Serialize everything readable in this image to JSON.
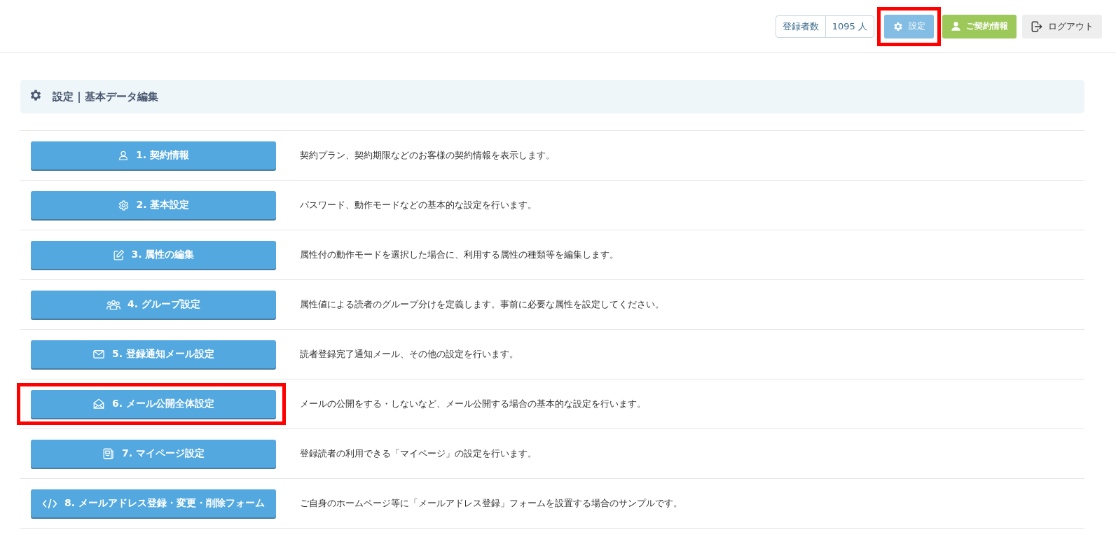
{
  "header": {
    "subscriber_count": {
      "label": "登録者数",
      "value": "1095 人"
    },
    "buttons": [
      {
        "kind": "settings",
        "label": "設定",
        "highlighted": true
      },
      {
        "kind": "contract",
        "label": "ご契約情報",
        "highlighted": false
      },
      {
        "kind": "logout",
        "label": "ログアウト",
        "highlighted": false
      }
    ]
  },
  "page_title": "設定 | 基本データ編集",
  "menu": [
    {
      "kind": "user",
      "label": "1. 契約情報",
      "description": "契約プラン、契約期限などのお客様の契約情報を表示します。",
      "highlighted": false
    },
    {
      "kind": "gear",
      "label": "2. 基本設定",
      "description": "パスワード、動作モードなどの基本的な設定を行います。",
      "highlighted": false
    },
    {
      "kind": "edit",
      "label": "3. 属性の編集",
      "description": "属性付の動作モードを選択した場合に、利用する属性の種類等を編集します。",
      "highlighted": false
    },
    {
      "kind": "group",
      "label": "4. グループ設定",
      "description": "属性値による読者のグループ分けを定義します。事前に必要な属性を設定してください。",
      "highlighted": false
    },
    {
      "kind": "mail",
      "label": "5. 登録通知メール設定",
      "description": "読者登録完了通知メール、その他の設定を行います。",
      "highlighted": false
    },
    {
      "kind": "mail-open",
      "label": "6. メール公開全体設定",
      "description": "メールの公開をする・しないなど、メール公開する場合の基本的な設定を行います。",
      "highlighted": true
    },
    {
      "kind": "page",
      "label": "7. マイページ設定",
      "description": "登録読者の利用できる「マイページ」の設定を行います。",
      "highlighted": false
    },
    {
      "kind": "code",
      "label": "8. メールアドレス登録・変更・削除フォーム",
      "description": "ご自身のホームページ等に「メールアドレス登録」フォームを設置する場合のサンプルです。",
      "highlighted": false
    }
  ]
}
